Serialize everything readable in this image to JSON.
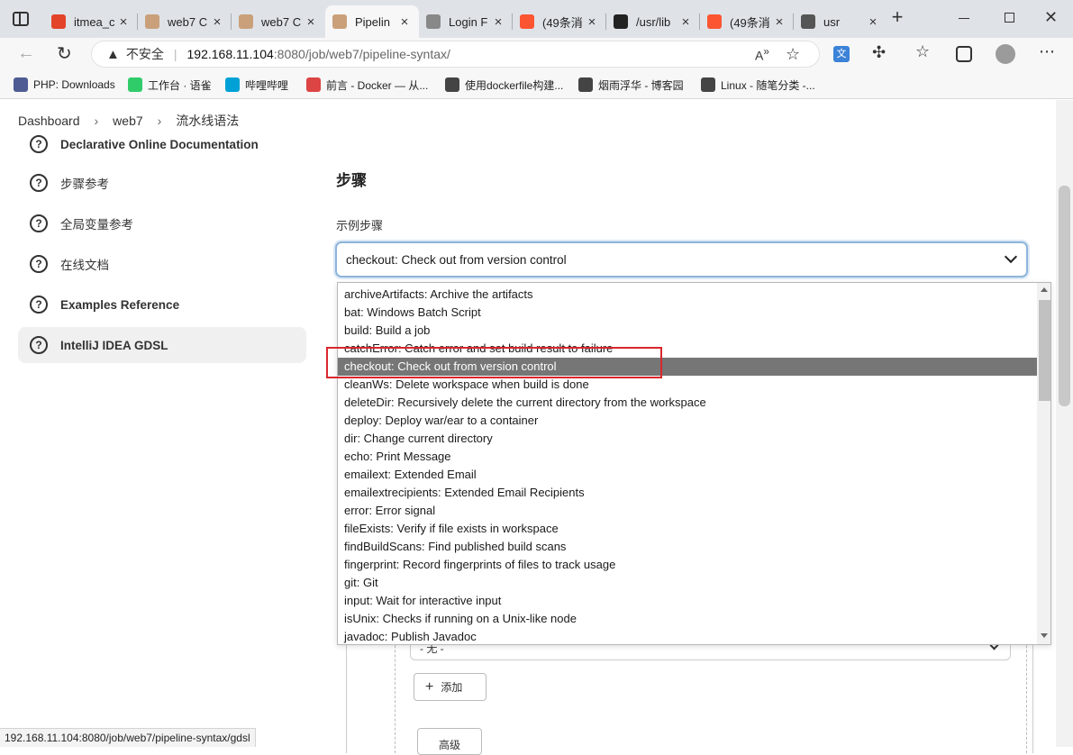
{
  "tabs": [
    {
      "label": "itmea_c",
      "icon": "gitlab-icon",
      "color": "#e24329"
    },
    {
      "label": "web7 C",
      "icon": "jenkins-icon",
      "color": "#c9a07a"
    },
    {
      "label": "web7 C",
      "icon": "jenkins-icon",
      "color": "#c9a07a"
    },
    {
      "label": "Pipelin",
      "icon": "jenkins-icon",
      "color": "#c9a07a",
      "active": true
    },
    {
      "label": "Login F",
      "icon": "chart-icon",
      "color": "#888888"
    },
    {
      "label": "(49条消",
      "icon": "csdn-icon",
      "color": "#fc5531"
    },
    {
      "label": "/usr/lib",
      "icon": "github-icon",
      "color": "#222222"
    },
    {
      "label": "(49条消",
      "icon": "csdn-icon",
      "color": "#fc5531"
    },
    {
      "label": "usr",
      "icon": "page-icon",
      "color": "#555555"
    }
  ],
  "address": {
    "security": "不安全",
    "url_host": "192.168.11.104",
    "url_rest": ":8080/job/web7/pipeline-syntax/"
  },
  "bookmarks": [
    {
      "label": "PHP: Downloads",
      "icon": "php-icon",
      "color": "#4f5b93"
    },
    {
      "label": "工作台 · 语雀",
      "icon": "yuque-icon",
      "color": "#31cc6a"
    },
    {
      "label": "哔哩哔哩",
      "icon": "bilibili-icon",
      "color": "#00a1d6"
    },
    {
      "label": "前言 - Docker — 从...",
      "icon": "rocket-icon",
      "color": "#d44"
    },
    {
      "label": "使用dockerfile构建...",
      "icon": "cnblogs-icon",
      "color": "#444"
    },
    {
      "label": "烟雨浮华 - 博客园",
      "icon": "cnblogs-icon",
      "color": "#444"
    },
    {
      "label": "Linux - 随笔分类 -...",
      "icon": "cnblogs-icon",
      "color": "#444"
    }
  ],
  "breadcrumb": [
    "Dashboard",
    "web7",
    "流水线语法"
  ],
  "sidebar": [
    {
      "label": "Declarative Online Documentation"
    },
    {
      "label": "步骤参考"
    },
    {
      "label": "全局变量参考"
    },
    {
      "label": "在线文档"
    },
    {
      "label": "Examples Reference"
    },
    {
      "label": "IntelliJ IDEA GDSL",
      "selected": true
    }
  ],
  "main": {
    "heading": "步骤",
    "field_label": "示例步骤",
    "select_value": "checkout: Check out from version control",
    "below_select_value": "- 无 -",
    "add_button": "添加",
    "advanced_button": "高级"
  },
  "dropdown_options": [
    "archiveArtifacts: Archive the artifacts",
    "bat: Windows Batch Script",
    "build: Build a job",
    "catchError: Catch error and set build result to failure",
    "checkout: Check out from version control",
    "cleanWs: Delete workspace when build is done",
    "deleteDir: Recursively delete the current directory from the workspace",
    "deploy: Deploy war/ear to a container",
    "dir: Change current directory",
    "echo: Print Message",
    "emailext: Extended Email",
    "emailextrecipients: Extended Email Recipients",
    "error: Error signal",
    "fileExists: Verify if file exists in workspace",
    "findBuildScans: Find published build scans",
    "fingerprint: Record fingerprints of files to track usage",
    "git: Git",
    "input: Wait for interactive input",
    "isUnix: Checks if running on a Unix-like node",
    "javadoc: Publish Javadoc"
  ],
  "highlighted_option": "checkout: Check out from version control",
  "status_url": "192.168.11.104:8080/job/web7/pipeline-syntax/gdsl",
  "colors": {
    "highlight": "#767676",
    "annotation_box": "#d9272e",
    "select_border": "#8fb4d9"
  }
}
